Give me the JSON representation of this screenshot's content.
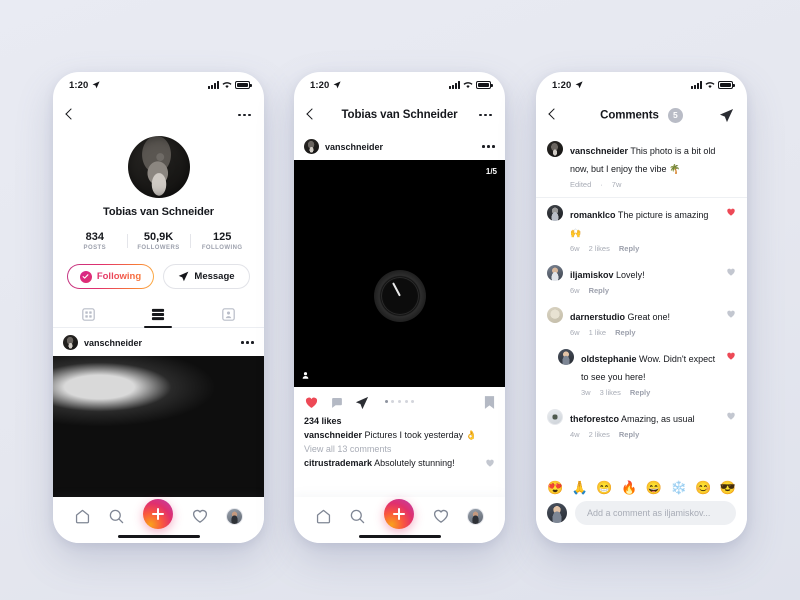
{
  "background_color": "#e7e9f1",
  "accent": {
    "gradient_start": "#c13584",
    "gradient_mid": "#e1306c",
    "gradient_end": "#fcaf45",
    "heart_red": "#ed4956",
    "muted": "#a8acb6"
  },
  "status_bar": {
    "time": "1:20",
    "location_icon": "location-arrow-icon",
    "signal_icon": "cellular-bars-icon",
    "wifi_icon": "wifi-icon",
    "battery_icon": "battery-full-icon"
  },
  "phone1": {
    "name": "profile-screen",
    "navbar": {
      "back_icon": "chevron-left-icon",
      "more_icon": "more-options-icon"
    },
    "profile": {
      "avatar": "profile-avatar",
      "display_name": "Tobias van Schneider",
      "stats": [
        {
          "value": "834",
          "label": "POSTS"
        },
        {
          "value": "50,9K",
          "label": "FOLLOWERS"
        },
        {
          "value": "125",
          "label": "FOLLOWING"
        }
      ],
      "following_button": "Following",
      "message_button": "Message",
      "tabs": [
        {
          "icon": "grid-icon",
          "active": false
        },
        {
          "icon": "feed-list-icon",
          "active": true
        },
        {
          "icon": "tagged-person-icon",
          "active": false
        }
      ]
    },
    "feed_post": {
      "username": "vanschneider",
      "more_icon": "more-options-icon",
      "image": "abstract-texture-photo"
    },
    "tabbar": [
      {
        "icon": "home-icon",
        "name": "home"
      },
      {
        "icon": "search-icon",
        "name": "search"
      },
      {
        "icon": "plus-icon",
        "name": "create"
      },
      {
        "icon": "heart-icon",
        "name": "activity"
      },
      {
        "icon": "avatar-icon",
        "name": "profile"
      }
    ]
  },
  "phone2": {
    "name": "post-detail-screen",
    "navbar": {
      "back_icon": "chevron-left-icon",
      "title": "Tobias van Schneider",
      "more_icon": "more-options-icon"
    },
    "post": {
      "username": "vanschneider",
      "more_icon": "more-options-icon",
      "image": "black-watch-photo",
      "carousel_index": "1/5",
      "carousel_dots": 5,
      "carousel_active_dot": 1,
      "tag_icon": "tagged-person-icon",
      "like_icon": "heart-filled-icon",
      "comment_icon": "comment-bubble-icon",
      "share_icon": "send-icon",
      "save_icon": "bookmark-icon",
      "likes": "234 likes",
      "caption_user": "vanschneider",
      "caption_text": "Pictures I took yesterday 👌",
      "view_all": "View all 13 comments",
      "preview_comment_user": "citrustrademark",
      "preview_comment_text": "Absolutely stunning!"
    },
    "tabbar": [
      {
        "icon": "home-icon",
        "name": "home"
      },
      {
        "icon": "search-icon",
        "name": "search"
      },
      {
        "icon": "plus-icon",
        "name": "create"
      },
      {
        "icon": "heart-icon",
        "name": "activity"
      },
      {
        "icon": "avatar-icon",
        "name": "profile"
      }
    ]
  },
  "phone3": {
    "name": "comments-screen",
    "navbar": {
      "back_icon": "chevron-left-icon",
      "title": "Comments",
      "count": "5",
      "send_icon": "send-icon"
    },
    "owner_comment": {
      "user": "vanschneider",
      "text": "This photo is a bit old now, but I enjoy the vibe 🌴",
      "edited": "Edited",
      "time": "7w"
    },
    "comments": [
      {
        "user": "romanklco",
        "text": "The picture is amazing 🙌",
        "time": "6w",
        "likes": "2 likes",
        "reply": "Reply",
        "liked": true
      },
      {
        "user": "iljamiskov",
        "text": "Lovely!",
        "time": "6w",
        "likes": "",
        "reply": "Reply",
        "liked": false
      },
      {
        "user": "darnerstudio",
        "text": "Great one!",
        "time": "6w",
        "likes": "1 like",
        "reply": "Reply",
        "liked": false
      },
      {
        "user": "oldstephanie",
        "text": "Wow. Didn't expect to see you here!",
        "time": "3w",
        "likes": "3 likes",
        "reply": "Reply",
        "liked": true,
        "indent": true
      },
      {
        "user": "theforestco",
        "text": "Amazing, as usual",
        "time": "4w",
        "likes": "2 likes",
        "reply": "Reply",
        "liked": false
      }
    ],
    "emoji_quick": [
      "😍",
      "🙏",
      "😁",
      "🔥",
      "😄",
      "❄️",
      "😊",
      "😎"
    ],
    "comment_input": {
      "placeholder": "Add a comment as iljamiskov...",
      "avatar": "current-user-avatar"
    }
  }
}
